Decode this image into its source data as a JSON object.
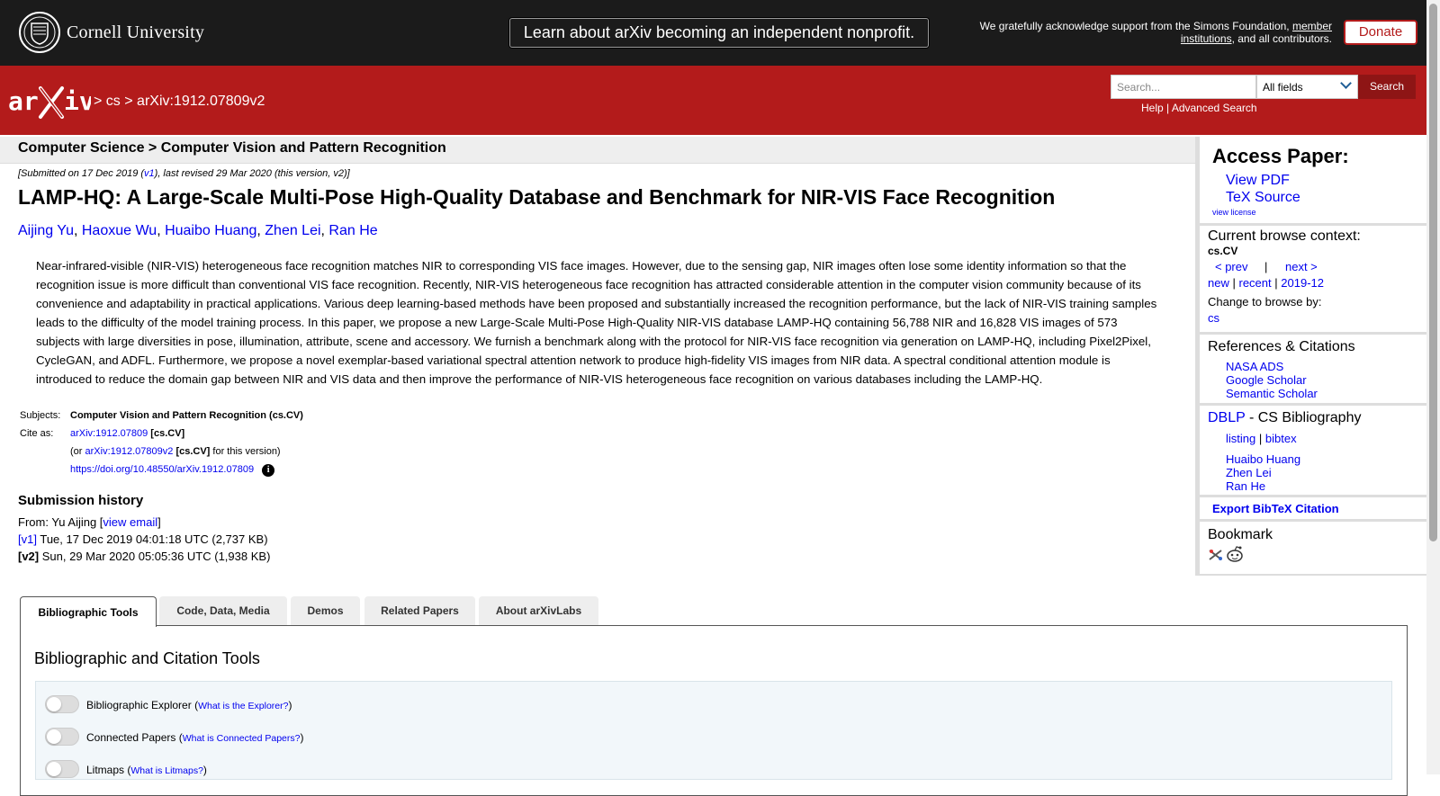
{
  "topbar": {
    "university": "Cornell University",
    "announcement": "Learn about arXiv becoming an independent nonprofit.",
    "support_prefix": "We gratefully acknowledge support from the Simons Foundation,",
    "support_link": "member institutions",
    "support_suffix": ", and all contributors.",
    "donate": "Donate"
  },
  "header": {
    "breadcrumb_sep1": ">",
    "breadcrumb_cs": "cs",
    "breadcrumb_sep2": ">",
    "breadcrumb_id": "arXiv:1912.07809v2",
    "search_placeholder": "Search...",
    "field_selected": "All fields",
    "search_button": "Search",
    "help": "Help",
    "help_sep": "|",
    "advanced": "Advanced Search"
  },
  "paper": {
    "subject_path": "Computer Science > Computer Vision and Pattern Recognition",
    "dateline_a": "[Submitted on 17 Dec 2019 (",
    "dateline_v1": "v1",
    "dateline_b": "), last revised 29 Mar 2020 (this version, v2)]",
    "title": "LAMP-HQ: A Large-Scale Multi-Pose High-Quality Database and Benchmark for NIR-VIS Face Recognition",
    "authors": [
      "Aijing Yu",
      "Haoxue Wu",
      "Huaibo Huang",
      "Zhen Lei",
      "Ran He"
    ],
    "abstract": "Near-infrared-visible (NIR-VIS) heterogeneous face recognition matches NIR to corresponding VIS face images. However, due to the sensing gap, NIR images often lose some identity information so that the recognition issue is more difficult than conventional VIS face recognition. Recently, NIR-VIS heterogeneous face recognition has attracted considerable attention in the computer vision community because of its convenience and adaptability in practical applications. Various deep learning-based methods have been proposed and substantially increased the recognition performance, but the lack of NIR-VIS training samples leads to the difficulty of the model training process. In this paper, we propose a new Large-Scale Multi-Pose High-Quality NIR-VIS database LAMP-HQ containing 56,788 NIR and 16,828 VIS images of 573 subjects with large diversities in pose, illumination, attribute, scene and accessory. We furnish a benchmark along with the protocol for NIR-VIS face recognition via generation on LAMP-HQ, including Pixel2Pixel, CycleGAN, and ADFL. Furthermore, we propose a novel exemplar-based variational spectral attention network to produce high-fidelity VIS images from NIR data. A spectral conditional attention module is introduced to reduce the domain gap between NIR and VIS data and then improve the performance of NIR-VIS heterogeneous face recognition on various databases including the LAMP-HQ.",
    "subjects_label": "Subjects:",
    "subjects_value": "Computer Vision and Pattern Recognition (cs.CV)",
    "cite_label": "Cite as:",
    "cite_id": "arXiv:1912.07809",
    "cite_cat": "[cs.CV]",
    "cite_or": "(or",
    "cite_v2": "arXiv:1912.07809v2",
    "cite_cat2": "[cs.CV]",
    "cite_this": "for this version)",
    "doi": "https://doi.org/10.48550/arXiv.1912.07809",
    "info_glyph": "i"
  },
  "history": {
    "title": "Submission history",
    "from_label": "From: Yu Aijing [",
    "view_email": "view email",
    "from_end": "]",
    "v1_link": "[v1]",
    "v1_text": "Tue, 17 Dec 2019 04:01:18 UTC (2,737 KB)",
    "v2_label": "[v2]",
    "v2_text": "Sun, 29 Mar 2020 05:05:36 UTC (1,938 KB)"
  },
  "sidebar": {
    "access_title": "Access Paper:",
    "view_pdf": "View PDF",
    "tex_source": "TeX Source",
    "view_license": "view license",
    "browse_title": "Current browse context:",
    "browse_cat": "cs.CV",
    "prev": "< prev",
    "sep": "|",
    "next": "next >",
    "new": "new",
    "recent": "recent",
    "month": "2019-12",
    "change_browse": "Change to browse by:",
    "browse_cs": "cs",
    "refs_title": "References & Citations",
    "nasa": "NASA ADS",
    "google": "Google Scholar",
    "semantic": "Semantic Scholar",
    "dblp": "DBLP",
    "dblp_rest": " - CS Bibliography",
    "listing": "listing",
    "bibtex": "bibtex",
    "dblp_authors": [
      "Huaibo Huang",
      "Zhen Lei",
      "Ran He"
    ],
    "export": "Export BibTeX Citation",
    "bookmark_title": "Bookmark"
  },
  "tabs": {
    "items": [
      "Bibliographic Tools",
      "Code, Data, Media",
      "Demos",
      "Related Papers",
      "About arXivLabs"
    ],
    "panel_title": "Bibliographic and Citation Tools",
    "tools": [
      {
        "label": "Bibliographic Explorer",
        "link": "What is the Explorer?"
      },
      {
        "label": "Connected Papers",
        "link": "What is Connected Papers?"
      },
      {
        "label": "Litmaps",
        "link": "What is Litmaps?"
      }
    ]
  },
  "colors": {
    "arxiv_red": "#b31b1b",
    "topbar": "#1b1b1b",
    "link": "#0000ee"
  }
}
